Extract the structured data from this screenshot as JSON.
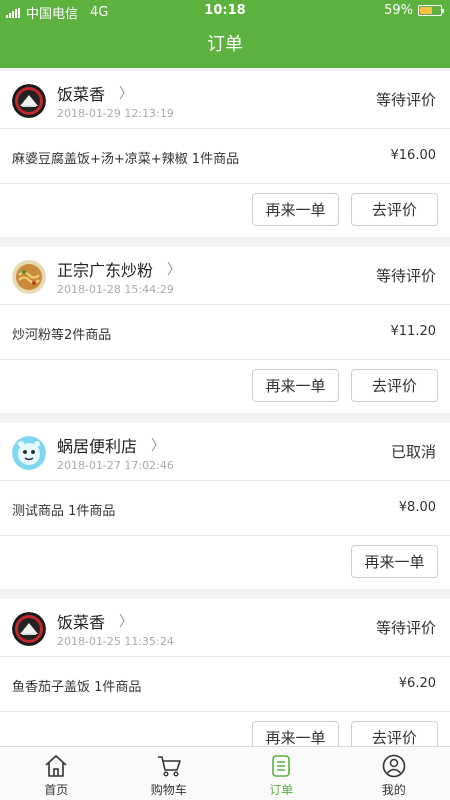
{
  "status_bar": {
    "carrier": "中国电信",
    "network": "4G",
    "time": "10:18",
    "battery": "59%",
    "battery_level": 0.59
  },
  "header": {
    "title": "订单"
  },
  "orders": [
    {
      "shop": "饭菜香",
      "time": "2018-01-29 12:13:19",
      "status": "等待评价",
      "items": "麻婆豆腐盖饭+汤+凉菜+辣椒 1件商品",
      "price": "¥16.00",
      "actions": [
        "再来一单",
        "去评价"
      ],
      "avatar_icon": "restaurant-logo-icon"
    },
    {
      "shop": "正宗广东炒粉",
      "time": "2018-01-28 15:44:29",
      "status": "等待评价",
      "items": "炒河粉等2件商品",
      "price": "¥11.20",
      "actions": [
        "再来一单",
        "去评价"
      ],
      "avatar_icon": "fried-noodles-icon"
    },
    {
      "shop": "蜗居便利店",
      "time": "2018-01-27 17:02:46",
      "status": "已取消",
      "items": "测试商品 1件商品",
      "price": "¥8.00",
      "actions": [
        "再来一单"
      ],
      "avatar_icon": "store-mascot-icon"
    },
    {
      "shop": "饭菜香",
      "time": "2018-01-25 11:35:24",
      "status": "等待评价",
      "items": "鱼香茄子盖饭 1件商品",
      "price": "¥6.20",
      "actions": [
        "再来一单",
        "去评价"
      ],
      "avatar_icon": "restaurant-logo-icon"
    }
  ],
  "tabbar": [
    {
      "label": "首页",
      "icon": "home-icon"
    },
    {
      "label": "购物车",
      "icon": "cart-icon"
    },
    {
      "label": "订单",
      "icon": "orders-icon",
      "active": true
    },
    {
      "label": "我的",
      "icon": "profile-icon"
    }
  ],
  "colors": {
    "accent": "#5cb13f",
    "battery": "#f5c542"
  }
}
